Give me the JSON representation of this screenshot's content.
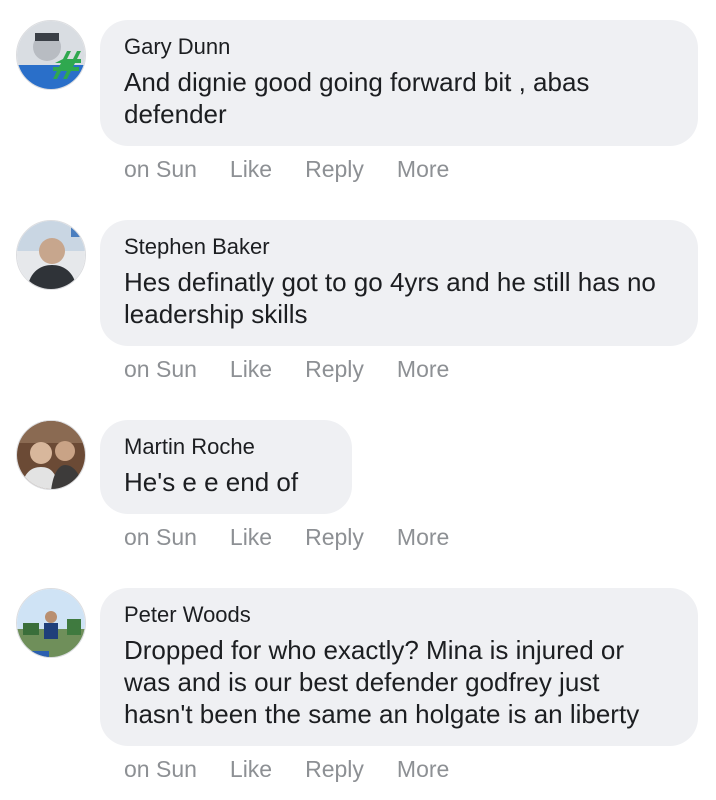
{
  "comments": [
    {
      "author": "Gary Dunn",
      "text": "And dignie good going forward bit , abas defender",
      "time": "on Sun",
      "like": "Like",
      "reply": "Reply",
      "more": "More"
    },
    {
      "author": "Stephen Baker",
      "text": "Hes definatly got to go 4yrs and he still has no leadership skills",
      "time": "on Sun",
      "like": "Like",
      "reply": "Reply",
      "more": "More"
    },
    {
      "author": "Martin Roche",
      "text": "He's e e end of",
      "time": "on Sun",
      "like": "Like",
      "reply": "Reply",
      "more": "More"
    },
    {
      "author": "Peter Woods",
      "text": "Dropped for who exactly? Mina is injured or was and is our best defender godfrey just hasn't been the same an holgate is an liberty",
      "time": "on Sun",
      "like": "Like",
      "reply": "Reply",
      "more": "More"
    }
  ]
}
